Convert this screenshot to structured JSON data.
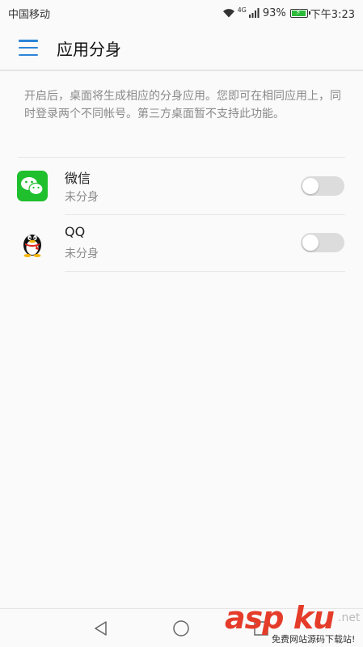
{
  "status_bar": {
    "carrier": "中国移动",
    "network_type": "4G",
    "battery_percent": "93%",
    "battery_level": 0.93,
    "time": "下午3:23"
  },
  "header": {
    "title": "应用分身"
  },
  "description": "开启后，桌面将生成相应的分身应用。您即可在相同应用上，同时登录两个不同帐号。第三方桌面暂不支持此功能。",
  "apps": [
    {
      "name": "微信",
      "status": "未分身",
      "icon": "wechat-icon",
      "enabled": false
    },
    {
      "name": "QQ",
      "status": "未分身",
      "icon": "qq-icon",
      "enabled": false
    }
  ],
  "watermark": {
    "main": "asp ku",
    "domain": ".net",
    "subtitle": "免费网站源码下载站!"
  },
  "colors": {
    "accent": "#2c84d8",
    "wechat_green": "#1fbf2e",
    "toggle_off": "#dcdcdc",
    "battery_green": "#2dbb3b",
    "watermark_red": "#e53c2a"
  }
}
